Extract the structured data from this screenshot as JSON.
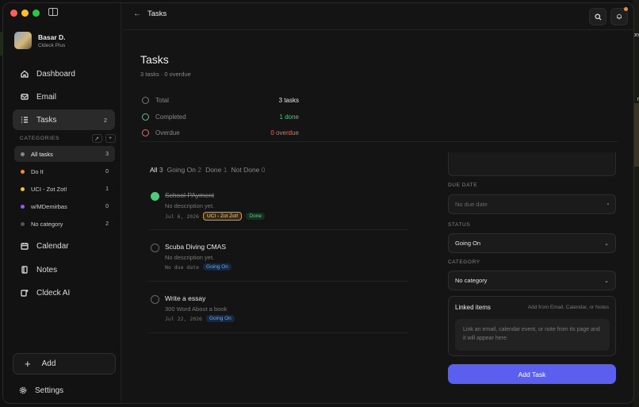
{
  "window": {
    "traffic_colors": [
      "#ff5f57",
      "#febc2e",
      "#28c840"
    ]
  },
  "user": {
    "name": "Basar D.",
    "plan": "Cldeck Plus"
  },
  "nav": [
    {
      "label": "Dashboard",
      "icon": "home-icon"
    },
    {
      "label": "Email",
      "icon": "mail-icon"
    },
    {
      "label": "Tasks",
      "icon": "list-icon",
      "count": "2",
      "active": true
    }
  ],
  "categories_header": "CATEGORIES",
  "categories": [
    {
      "label": "All tasks",
      "count": "3",
      "color": "#888888"
    },
    {
      "label": "Do It",
      "count": "0",
      "color": "#f08a3a"
    },
    {
      "label": "UCI - Zot Zot!",
      "count": "1",
      "color": "#f0c040"
    },
    {
      "label": "w/MDemirbas",
      "count": "0",
      "color": "#9b59e8"
    },
    {
      "label": "No category",
      "count": "2",
      "color": "#555555"
    }
  ],
  "nav2": [
    {
      "label": "Calendar",
      "icon": "calendar-icon"
    },
    {
      "label": "Notes",
      "icon": "notes-icon"
    },
    {
      "label": "Cldeck AI",
      "icon": "ai-icon"
    }
  ],
  "add_label": "Add",
  "settings_label": "Settings",
  "topbar": {
    "title": "Tasks",
    "back": "←"
  },
  "page": {
    "title": "Tasks",
    "subtitle": "3 tasks · 0 overdue"
  },
  "stats": [
    {
      "label": "Total",
      "value": "3 tasks",
      "color": "#e6e6e6"
    },
    {
      "label": "Completed",
      "value": "1 done",
      "color": "#4ccb7a"
    },
    {
      "label": "Overdue",
      "value": "0 overdue",
      "color": "#f06a5a"
    }
  ],
  "tabs": [
    {
      "label": "All",
      "count": "3",
      "active": true
    },
    {
      "label": "Going On",
      "count": "2"
    },
    {
      "label": "Done",
      "count": "1"
    },
    {
      "label": "Not Done",
      "count": "0"
    }
  ],
  "tasks": [
    {
      "title": "School PAyment",
      "desc": "No description yet.",
      "date": "Jul 6, 2026",
      "badges": [
        {
          "text": "UCI - Zot Zot!",
          "kind": "uci"
        },
        {
          "text": "Done",
          "kind": "done"
        }
      ],
      "done": true
    },
    {
      "title": "Scuba Diving CMAS",
      "desc": "No description yet.",
      "date": "No due date",
      "badges": [
        {
          "text": "Going On",
          "kind": "going"
        }
      ],
      "done": false
    },
    {
      "title": "Write a essay",
      "desc": "300 Word About a book",
      "date": "Jul 22, 2026",
      "badges": [
        {
          "text": "Going On",
          "kind": "going"
        }
      ],
      "done": false
    }
  ],
  "form": {
    "due_label": "DUE DATE",
    "due_placeholder": "No due date",
    "status_label": "STATUS",
    "status_value": "Going On",
    "category_label": "CATEGORY",
    "category_value": "No category",
    "linked_title": "Linked items",
    "linked_hint": "Add from Email, Calendar, or Notes",
    "linked_empty": "Link an email, calendar event, or note from its page and it will appear here.",
    "submit": "Add Task"
  },
  "edge_text": [
    "on",
    "r"
  ]
}
